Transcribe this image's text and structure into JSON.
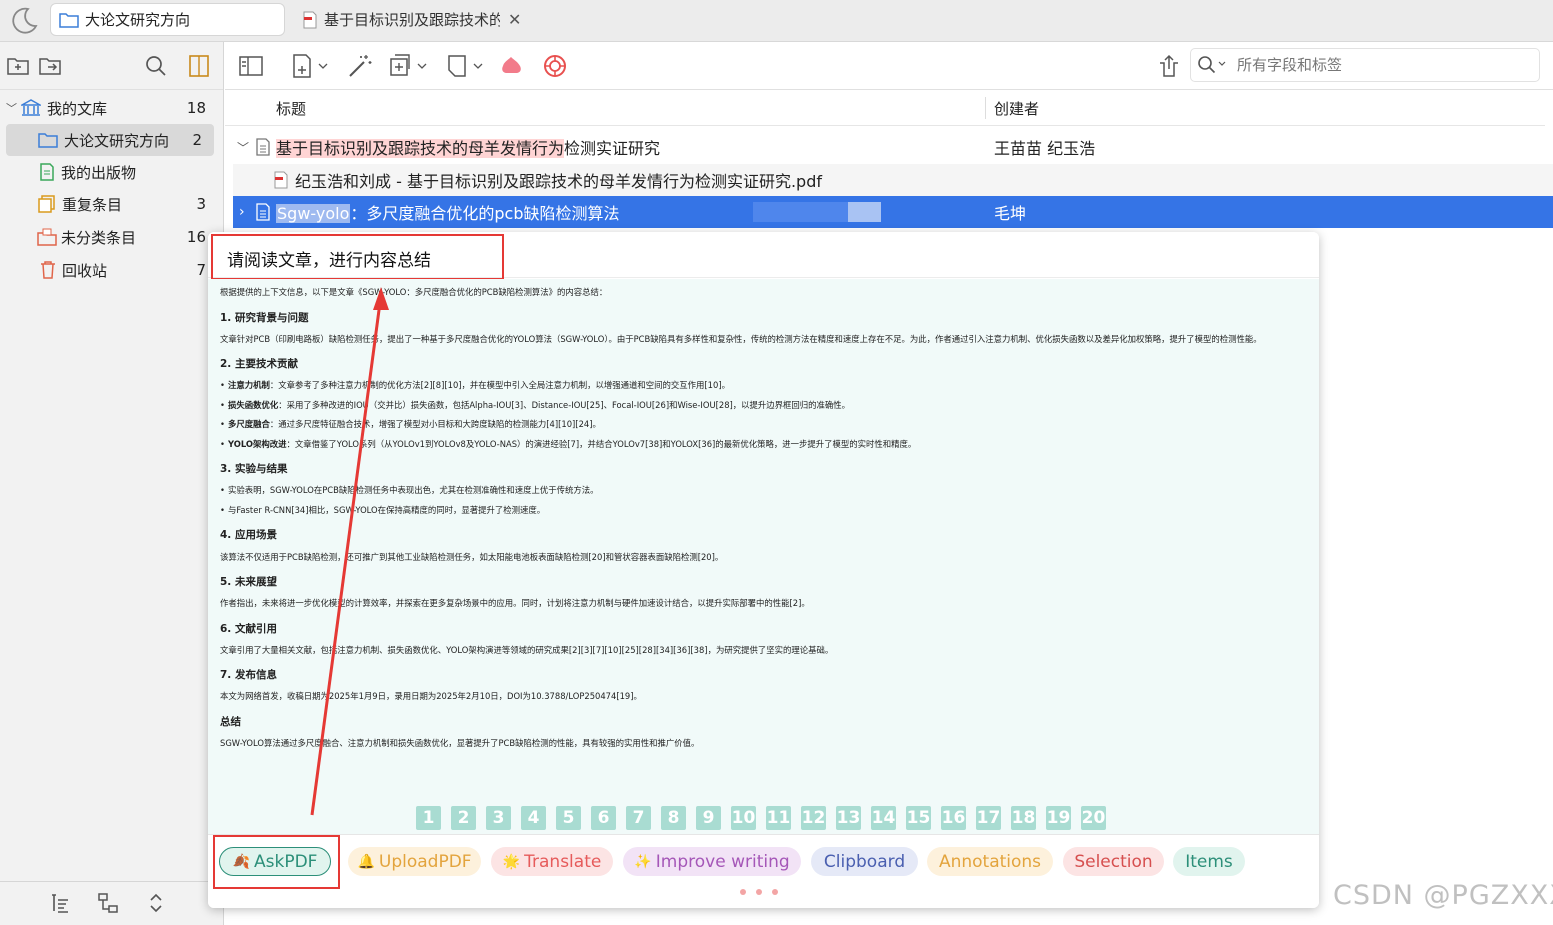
{
  "tabs": [
    {
      "label": "大论文研究方向"
    },
    {
      "label": "基于目标识别及跟踪技术的"
    }
  ],
  "sidebar": {
    "items": [
      {
        "label": "我的文库",
        "count": "18"
      },
      {
        "label": "大论文研究方向",
        "count": "2"
      },
      {
        "label": "我的出版物",
        "count": ""
      },
      {
        "label": "重复条目",
        "count": "3"
      },
      {
        "label": "未分类条目",
        "count": "16"
      },
      {
        "label": "回收站",
        "count": "7"
      }
    ]
  },
  "search": {
    "placeholder": "所有字段和标签"
  },
  "columns": {
    "title": "标题",
    "creator": "创建者"
  },
  "rows": [
    {
      "title_hl": "基于目标识别及跟踪技术的母羊发情行为",
      "title_rest": "检测实证研究",
      "creator": "王苗苗 纪玉浩"
    },
    {
      "title": "纪玉浩和刘成 - 基于目标识别及跟踪技术的母羊发情行为检测实证研究.pdf",
      "creator": ""
    },
    {
      "title_hl": "Sgw-yolo",
      "title_rest": "：多尺度融合优化的pcb缺陷检测算法",
      "creator": "毛坤"
    }
  ],
  "popup": {
    "prompt": "请阅读文章，进行内容总结",
    "answer": {
      "intro": "根据提供的上下文信息，以下是文章《SGW-YOLO：多尺度融合优化的PCB缺陷检测算法》的内容总结：",
      "s1_title": "1. 研究背景与问题",
      "s1_text": "文章针对PCB（印刷电路板）缺陷检测任务，提出了一种基于多尺度融合优化的YOLO算法（SGW-YOLO）。由于PCB缺陷具有多样性和复杂性，传统的检测方法在精度和速度上存在不足。为此，作者通过引入注意力机制、优化损失函数以及差异化加权策略，提升了模型的检测性能。",
      "s2_title": "2. 主要技术贡献",
      "s2_items": [
        {
          "b": "注意力机制",
          "t": "：文章参考了多种注意力机制的优化方法[2][8][10]，并在模型中引入全局注意力机制，以增强通道和空间的交互作用[10]。"
        },
        {
          "b": "损失函数优化",
          "t": "：采用了多种改进的IOU（交并比）损失函数，包括Alpha-IOU[3]、Distance-IOU[25]、Focal-IOU[26]和Wise-IOU[28]，以提升边界框回归的准确性。"
        },
        {
          "b": "多尺度融合",
          "t": "：通过多尺度特征融合技术，增强了模型对小目标和大跨度缺陷的检测能力[4][10][24]。"
        },
        {
          "b": "YOLO架构改进",
          "t": "：文章借鉴了YOLO系列（从YOLOv1到YOLOv8及YOLO-NAS）的演进经验[7]，并结合YOLOv7[38]和YOLOX[36]的最新优化策略，进一步提升了模型的实时性和精度。"
        }
      ],
      "s3_title": "3. 实验与结果",
      "s3_items": [
        "实验表明，SGW-YOLO在PCB缺陷检测任务中表现出色，尤其在检测准确性和速度上优于传统方法。",
        "与Faster R-CNN[34]相比，SGW-YOLO在保持高精度的同时，显著提升了检测速度。"
      ],
      "s4_title": "4. 应用场景",
      "s4_text": "该算法不仅适用于PCB缺陷检测，还可推广到其他工业缺陷检测任务，如太阳能电池板表面缺陷检测[20]和管状容器表面缺陷检测[20]。",
      "s5_title": "5. 未来展望",
      "s5_text": "作者指出，未来将进一步优化模型的计算效率，并探索在更多复杂场景中的应用。同时，计划将注意力机制与硬件加速设计结合，以提升实际部署中的性能[2]。",
      "s6_title": "6. 文献引用",
      "s6_text": "文章引用了大量相关文献，包括注意力机制、损失函数优化、YOLO架构演进等领域的研究成果[2][3][7][10][25][28][34][36][38]，为研究提供了坚实的理论基础。",
      "s7_title": "7. 发布信息",
      "s7_text": "本文为网络首发，收稿日期为2025年1月9日，录用日期为2025年2月10日，DOI为10.3788/LOP250474[19]。",
      "s8_title": "总结",
      "s8_text": "SGW-YOLO算法通过多尺度融合、注意力机制和损失函数优化，显著提升了PCB缺陷检测的性能，具有较强的实用性和推广价值。"
    },
    "pages": [
      "1",
      "2",
      "3",
      "4",
      "5",
      "6",
      "7",
      "8",
      "9",
      "10",
      "11",
      "12",
      "13",
      "14",
      "15",
      "16",
      "17",
      "18",
      "19",
      "20"
    ],
    "buttons": [
      {
        "label": "AskPDF",
        "emoji": "🍂"
      },
      {
        "label": "UploadPDF",
        "emoji": "🔔"
      },
      {
        "label": "Translate",
        "emoji": "🌟"
      },
      {
        "label": "Improve writing",
        "emoji": "✨"
      },
      {
        "label": "Clipboard",
        "emoji": ""
      },
      {
        "label": "Annotations",
        "emoji": ""
      },
      {
        "label": "Selection",
        "emoji": ""
      },
      {
        "label": "Items",
        "emoji": ""
      }
    ]
  },
  "watermark": "CSDN @PGZXXX",
  "colors": {
    "selection": "#3574e6",
    "annotation_red": "#e53935",
    "answer_bg": "#f1faf9",
    "page_btn": "#a9dcd2"
  }
}
